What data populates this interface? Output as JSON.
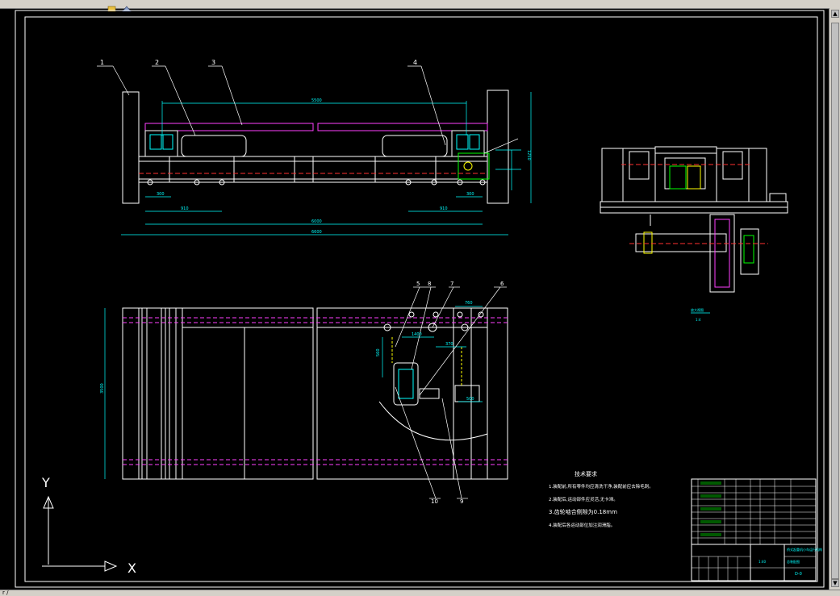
{
  "window": {
    "status_text": "r /"
  },
  "drawing": {
    "part_numbers": [
      "1",
      "2",
      "3",
      "4",
      "5",
      "8",
      "7",
      "6",
      "10",
      "9"
    ],
    "notes_title": "技术要求",
    "notes": [
      "1.装配前,所有零件均应清洗干净,装配前应去除毛刺。",
      "2.装配后,运动部件应灵活,无卡滞。",
      "3.齿轮啮合侧隙为0.18mm",
      "4.装配后各运动部位加注润滑脂。"
    ],
    "dims": {
      "top_span": "5500",
      "overall_inner": "6000",
      "overall_outer": "6600",
      "left_small_1": "300",
      "left_small_2": "910",
      "right_small_1": "300",
      "right_small_2": "910",
      "height_right": "1250",
      "plan_height": "3500",
      "plan_dim_1": "760",
      "plan_dim_2": "1400",
      "plan_dim_3": "560",
      "plan_dim_4": "370",
      "plan_dim_5": "500"
    },
    "detail_label": "放大视图",
    "detail_scale": "1:4",
    "axis_y": "Y",
    "axis_x": "X",
    "title_block": {
      "title": "桥式起重机小车运行机构",
      "drawing_no": "总装配图",
      "sheet": "1:40",
      "code": "D-0"
    }
  }
}
